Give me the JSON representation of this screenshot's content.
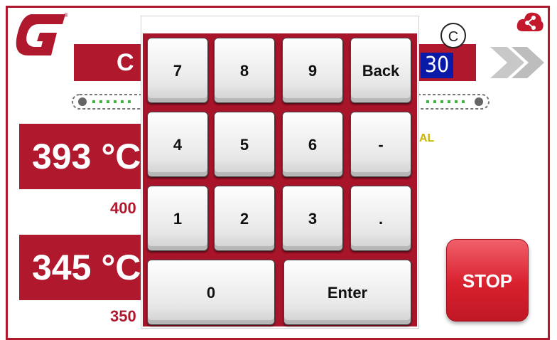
{
  "header": {
    "title_partial": "C",
    "value": "30",
    "callout_letter": "C"
  },
  "zones": [
    {
      "temperature": "393 °C",
      "setpoint": "400"
    },
    {
      "temperature": "345 °C",
      "setpoint": "350"
    }
  ],
  "status": {
    "al_label": "AL"
  },
  "stop_button": {
    "label": "STOP"
  },
  "keypad": {
    "keys": [
      "7",
      "8",
      "9",
      "Back",
      "4",
      "5",
      "6",
      "-",
      "1",
      "2",
      "3",
      ".",
      "0",
      "Enter"
    ]
  },
  "colors": {
    "brand": "#b0182e",
    "value_highlight": "#0a1aa8",
    "stop": "#d8202e"
  },
  "icons": {
    "logo": "company-logo",
    "share": "share-icon",
    "next": "double-chevron-right-icon"
  }
}
